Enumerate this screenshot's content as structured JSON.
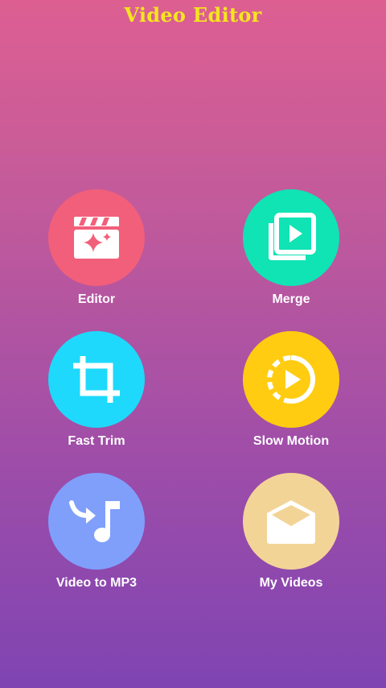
{
  "app": {
    "title": "Video Editor"
  },
  "colors": {
    "title": "#f4e51f",
    "editor": "#f25f7a",
    "merge": "#10e3b4",
    "fast_trim": "#1ed9fb",
    "slow_motion": "#ffcc12",
    "video_to_mp3": "#7f9ffb",
    "my_videos": "#f3d497"
  },
  "menu": [
    {
      "id": "editor",
      "label": "Editor",
      "icon": "clapperboard-sparkle-icon"
    },
    {
      "id": "merge",
      "label": "Merge",
      "icon": "video-library-icon"
    },
    {
      "id": "fast_trim",
      "label": "Fast Trim",
      "icon": "crop-icon"
    },
    {
      "id": "slow_motion",
      "label": "Slow Motion",
      "icon": "slow-motion-video-icon"
    },
    {
      "id": "video_to_mp3",
      "label": "Video to MP3",
      "icon": "forward-music-note-icon"
    },
    {
      "id": "my_videos",
      "label": "My Videos",
      "icon": "open-envelope-icon"
    }
  ]
}
